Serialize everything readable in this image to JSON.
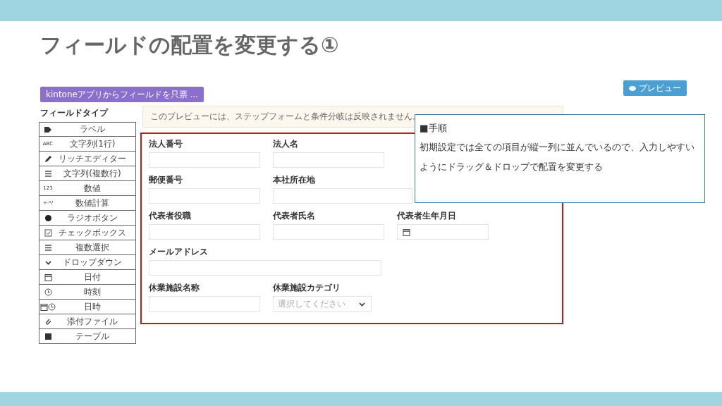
{
  "slide_title": "フィールドの配置を変更する①",
  "import_button": "kintoneアプリからフィールドを只票 ...",
  "preview_button": "プレビュー",
  "sidebar": {
    "heading": "フィールドタイプ",
    "items": [
      {
        "label": "ラベル"
      },
      {
        "icon_text": "ABC",
        "label": "文字列(1行)"
      },
      {
        "label": "リッチエディター"
      },
      {
        "label": "文字列(複数行)"
      },
      {
        "icon_text": "123",
        "label": "数値"
      },
      {
        "icon_text": "+-*/",
        "label": "数値計算"
      },
      {
        "label": "ラジオボタン"
      },
      {
        "label": "チェックボックス"
      },
      {
        "label": "複数選択"
      },
      {
        "label": "ドロップダウン"
      },
      {
        "label": "日付"
      },
      {
        "label": "時刻"
      },
      {
        "label": "日時"
      },
      {
        "label": "添付ファイル"
      },
      {
        "label": "テーブル"
      }
    ]
  },
  "notice": "このプレビューには、ステップフォームと条件分岐は反映されません。",
  "form_rows": [
    [
      {
        "kind": "text",
        "label": "法人番号"
      },
      {
        "kind": "text",
        "label": "法人名"
      }
    ],
    [
      {
        "kind": "text",
        "label": "郵便番号"
      },
      {
        "kind": "wide",
        "label": "本社所在地"
      }
    ],
    [
      {
        "kind": "text",
        "label": "代表者役職"
      },
      {
        "kind": "text",
        "label": "代表者氏名"
      },
      {
        "kind": "date",
        "label": "代表者生年月日"
      }
    ],
    [
      {
        "kind": "wide",
        "label": "メールアドレス"
      }
    ],
    [
      {
        "kind": "text",
        "label": "休業施設名称"
      },
      {
        "kind": "dropdown",
        "label": "休業施設カテゴリ",
        "placeholder": "選択してください"
      }
    ]
  ],
  "callout": {
    "heading": "■手順",
    "text": "初期設定では全ての項目が縦一列に並んでいるので、入力しやすいようにドラッグ＆ドロップで配置を変更する"
  }
}
